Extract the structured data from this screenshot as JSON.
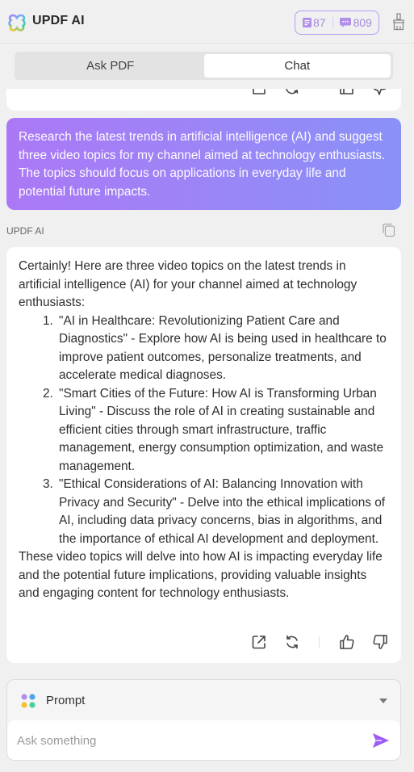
{
  "header": {
    "app_title": "UPDF AI",
    "quota": {
      "pdf_count": "87",
      "chat_count": "809",
      "accent": "#a58bdc"
    }
  },
  "tabs": [
    {
      "label": "Ask PDF",
      "active": false
    },
    {
      "label": "Chat",
      "active": true
    }
  ],
  "conversation": {
    "user_message": "Research the latest trends in artificial intelligence (AI) and suggest three video topics for my channel aimed at technology enthusiasts. The topics should focus on applications in everyday life and potential future impacts.",
    "ai_sender_label": "UPDF AI",
    "ai_response": {
      "intro": "Certainly! Here are three video topics on the latest trends in artificial intelligence (AI) for your channel aimed at technology enthusiasts:",
      "items": [
        {
          "num": "1.",
          "text": "\"AI in Healthcare: Revolutionizing Patient Care and Diagnostics\" - Explore how AI is being used in healthcare to improve patient outcomes, personalize treatments, and accelerate medical diagnoses."
        },
        {
          "num": "2.",
          "text": "\"Smart Cities of the Future: How AI is Transforming Urban Living\" - Discuss the role of AI in creating sustainable and efficient cities through smart infrastructure, traffic management, energy consumption optimization, and waste management."
        },
        {
          "num": "3.",
          "text": "\"Ethical Considerations of AI: Balancing Innovation with Privacy and Security\" - Delve into the ethical implications of AI, including data privacy concerns, bias in algorithms, and the importance of ethical AI development and deployment."
        }
      ],
      "outro": "These video topics will delve into how AI is impacting everyday life and the potential future implications, providing valuable insights and engaging content for technology enthusiasts."
    }
  },
  "composer": {
    "prompt_label": "Prompt",
    "input_value": "",
    "input_placeholder": "Ask something",
    "send_color": "#9b5cf6"
  }
}
